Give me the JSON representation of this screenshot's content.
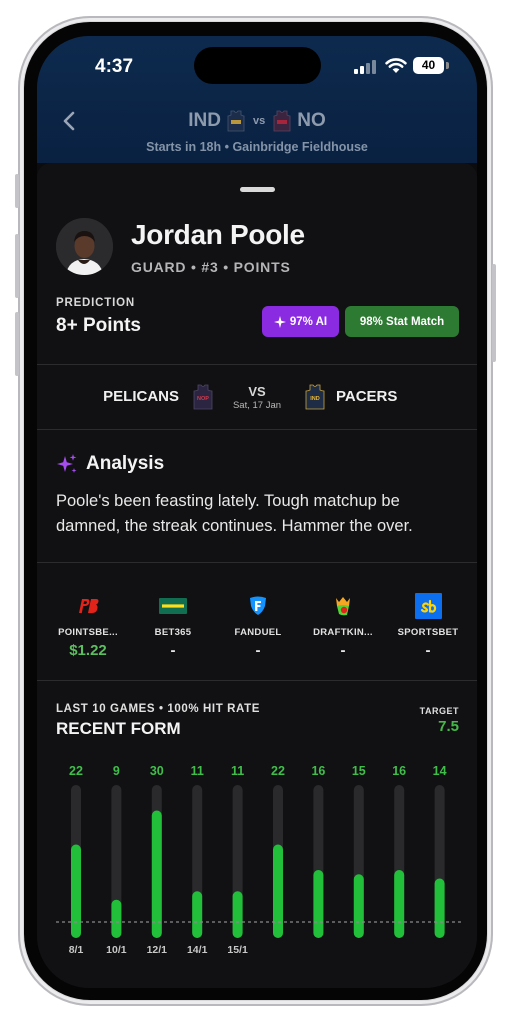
{
  "status_bar": {
    "time": "4:37",
    "battery": "40"
  },
  "match_header": {
    "home": "IND",
    "vs": "vs",
    "away": "NO",
    "subtitle": "Starts in 18h • Gainbridge Fieldhouse"
  },
  "player": {
    "name": "Jordan Poole",
    "meta": "GUARD • #3  •  POINTS"
  },
  "prediction": {
    "label": "PREDICTION",
    "value": "8+ Points",
    "ai_badge": "97% AI",
    "stat_badge": "98% Stat Match"
  },
  "matchup": {
    "home": "PELICANS",
    "home_jersey": "NOP",
    "vs": "VS",
    "date": "Sat, 17 Jan",
    "away_jersey": "IND",
    "away": "PACERS"
  },
  "analysis": {
    "title": "Analysis",
    "text": "Poole's been feasting lately. Tough matchup be damned, the streak continues. Hammer the over."
  },
  "books": [
    {
      "name": "POINTSBE...",
      "price": "$1.22",
      "logo": "PB",
      "color": "#e2231a"
    },
    {
      "name": "BET365",
      "price": "-",
      "logo": "bet365",
      "color": "#126e51"
    },
    {
      "name": "FANDUEL",
      "price": "-",
      "logo": "fanduel-shield",
      "color": "#1493ff"
    },
    {
      "name": "DRAFTKIN...",
      "price": "-",
      "logo": "draftkings-crown",
      "color": "#53d337"
    },
    {
      "name": "SPORTSBET",
      "price": "-",
      "logo": "sb",
      "color": "#0b6ff0"
    }
  ],
  "recent_form": {
    "subtitle": "LAST 10 GAMES • 100% HIT RATE",
    "title": "RECENT FORM",
    "target_label": "TARGET",
    "target": "7.5"
  },
  "chart_data": {
    "type": "bar",
    "values": [
      22,
      9,
      30,
      11,
      11,
      22,
      16,
      15,
      16,
      14
    ],
    "x_labels": [
      "8/1",
      "10/1",
      "12/1",
      "14/1",
      "15/1",
      "",
      "",
      "",
      "",
      ""
    ],
    "target": 7.5,
    "ylim": [
      0,
      36
    ],
    "bar_color": "#22c03a",
    "track_color": "#2a2a2c",
    "label_color": "#3fbf4a"
  }
}
